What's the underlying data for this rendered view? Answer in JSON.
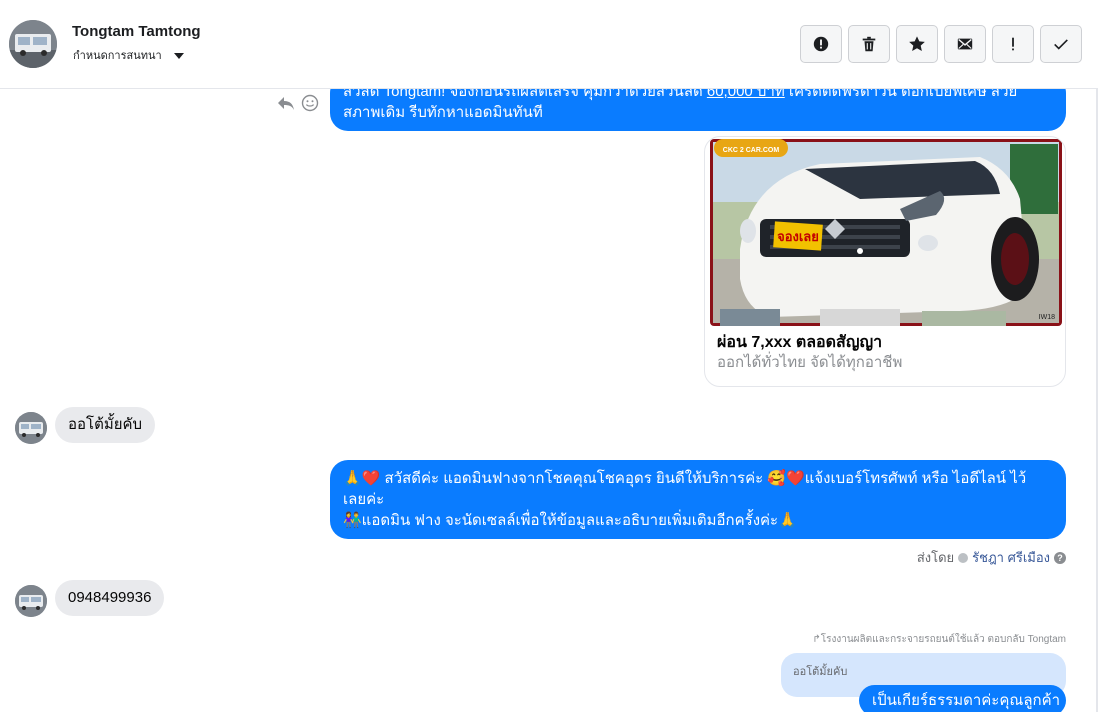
{
  "header": {
    "contact_name": "Tongtam Tamtong",
    "assign_label": "กำหนดการสนทนา"
  },
  "toolbar": {
    "buttons": [
      {
        "name": "report-spam",
        "icon": "alert-circle-icon"
      },
      {
        "name": "delete",
        "icon": "trash-icon"
      },
      {
        "name": "star",
        "icon": "star-icon"
      },
      {
        "name": "mark-unread",
        "icon": "envelope-icon"
      },
      {
        "name": "important",
        "icon": "exclamation-icon"
      },
      {
        "name": "mark-done",
        "icon": "check-icon"
      }
    ]
  },
  "messages": {
    "promo": {
      "line1_pre": "สวัสดี Tongtam! จองก่อนรถผลิตเสร็จ คุ้มกว่าด้วยส่วนลด ",
      "line1_link": "60,000 บาท",
      "line1_post": " เครดิตดีฟรีดาวน์ ดอกเบี้ยพิเศษ สวย",
      "line2": "สภาพเดิม รีบทักหาแอดมินทันที"
    },
    "card": {
      "title": "ผ่อน 7,xxx ตลอดสัญญา",
      "subtitle": "ออกได้ทั่วไทย จัดได้ทุกอาชีพ",
      "image_logo": "CKC 2 CAR.COM",
      "image_tag": "จองเลย",
      "image_corner": "IW18"
    },
    "customer_1": "ออโต้มั้ยคับ",
    "admin_reply": {
      "line1": "🙏❤️ สวัสดีค่ะ แอดมินฟางจากโชคคุณโชคอุดร ยินดีให้บริการค่ะ  🥰❤️แจ้งเบอร์โทรศัพท์ หรือ ไอดีไลน์  ไว้",
      "line2": "เลยค่ะ",
      "line3": "👫แอดมิน ฟาง จะนัดเซลล์เพื่อให้ข้อมูลและอธิบายเพิ่มเติมอีกครั้งค่ะ🙏"
    },
    "sent_by_label": "ส่งโดย",
    "sent_by_name": "รัชฎา ศรีเมือง",
    "customer_2": "0948499936",
    "reply_note": "โรงงานผลิตและกระจายรถยนต์ใช้แล้ว ตอบกลับ Tongtam",
    "quoted_text": "ออโต้มั้ยคับ",
    "last_reply": "เป็นเกียร์ธรรมดาค่ะคุณลูกค้า"
  },
  "colors": {
    "accent_blue": "#0a7cff",
    "bubble_grey": "#e9eaed",
    "quote_blue": "#d5e6fd"
  }
}
